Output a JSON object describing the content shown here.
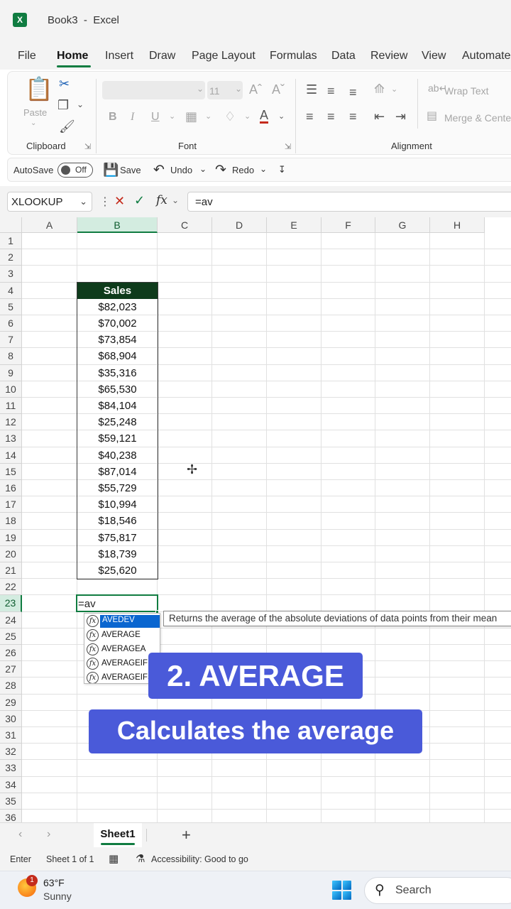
{
  "app": {
    "logo": "X",
    "title": "Book3  -  Excel"
  },
  "tabs": [
    "File",
    "Home",
    "Insert",
    "Draw",
    "Page Layout",
    "Formulas",
    "Data",
    "Review",
    "View",
    "Automate"
  ],
  "active_tab": "Home",
  "ribbon": {
    "clipboard": {
      "paste_label": "Paste",
      "group_label": "Clipboard"
    },
    "font": {
      "size": "11",
      "group_label": "Font",
      "bold": "B",
      "italic": "I",
      "underline": "U"
    },
    "alignment": {
      "wrap_text": "Wrap Text",
      "merge_center": "Merge & Center",
      "group_label": "Alignment"
    }
  },
  "qat": {
    "autosave": "AutoSave",
    "autosave_state": "Off",
    "save": "Save",
    "undo": "Undo",
    "redo": "Redo"
  },
  "formula_bar": {
    "name_box": "XLOOKUP",
    "formula": "=av"
  },
  "columns": [
    "A",
    "B",
    "C",
    "D",
    "E",
    "F",
    "G",
    "H"
  ],
  "rows": [
    "1",
    "2",
    "3",
    "4",
    "5",
    "6",
    "7",
    "8",
    "9",
    "10",
    "11",
    "12",
    "13",
    "14",
    "15",
    "16",
    "17",
    "18",
    "19",
    "20",
    "21",
    "22",
    "23",
    "24",
    "25",
    "26",
    "27",
    "28",
    "29",
    "30",
    "31",
    "32",
    "33",
    "34",
    "35",
    "36"
  ],
  "table": {
    "header": "Sales",
    "values": [
      "$82,023",
      "$70,002",
      "$73,854",
      "$68,904",
      "$35,316",
      "$65,530",
      "$84,104",
      "$25,248",
      "$59,121",
      "$40,238",
      "$87,014",
      "$55,729",
      "$10,994",
      "$18,546",
      "$75,817",
      "$18,739",
      "$25,620"
    ]
  },
  "active_cell": {
    "ref": "B23",
    "value": "=av"
  },
  "autocomplete": {
    "items": [
      "AVEDEV",
      "AVERAGE",
      "AVERAGEA",
      "AVERAGEIF",
      "AVERAGEIFS"
    ],
    "tooltip": "Returns the average of the absolute deviations of data points from their mean"
  },
  "captions": {
    "title": "2. AVERAGE",
    "subtitle": "Calculates the average"
  },
  "sheets": {
    "active": "Sheet1"
  },
  "status": {
    "mode": "Enter",
    "sheet_info": "Sheet 1 of 1",
    "accessibility": "Accessibility: Good to go"
  },
  "taskbar": {
    "badge": "1",
    "temperature": "63°F",
    "condition": "Sunny",
    "search": "Search"
  },
  "colors": {
    "excel_green": "#107c41",
    "header_fill": "#0e3b1b",
    "caption_bg": "#4a5ad9",
    "selection_blue": "#0a66d0"
  }
}
